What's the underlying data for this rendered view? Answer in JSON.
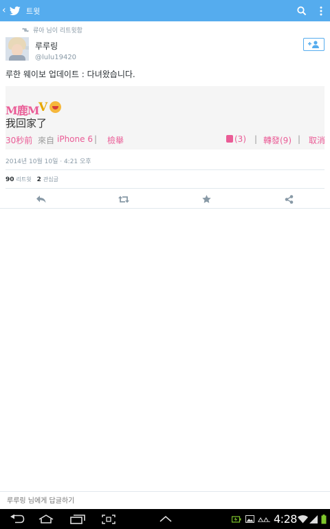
{
  "action_bar": {
    "title": "트윗",
    "background": "#55acee",
    "back_icon": "chevron-left-icon",
    "logo_icon": "twitter-bird-icon",
    "search_icon": "search-icon",
    "overflow_icon": "overflow-menu-icon"
  },
  "tweet": {
    "retweet_context": "류아 님이 리트윗함",
    "author": {
      "display_name": "루루링",
      "handle": "@lulu19420"
    },
    "text": "루한 웨이보 업데이트 : 다녀왔습니다.",
    "image": {
      "name_tag": "M鹿M",
      "v_badge": "V",
      "post_text": "我回家了",
      "time": "30秒前",
      "source_prefix": "來自",
      "source": "iPhone 6",
      "separator": "|",
      "report": "檢舉",
      "likes": "(3)",
      "repost": "轉發(9)",
      "cancel": "取消"
    },
    "timestamp": "2014년 10월 10일 · 4:21 오후",
    "retweet_count": "90",
    "retweet_label": "리트윗",
    "favorite_count": "2",
    "favorite_label": "관심글"
  },
  "actions": {
    "reply_icon": "reply-icon",
    "retweet_icon": "retweet-icon",
    "favorite_icon": "star-icon",
    "share_icon": "share-icon"
  },
  "reply_box": {
    "placeholder": "루루링 님에게 답글하기"
  },
  "system_bar": {
    "time": "4:28",
    "icons": [
      "back-icon",
      "home-icon",
      "recent-apps-icon",
      "screenshot-icon",
      "up-chevron-icon",
      "battery-charging-icon",
      "gallery-icon",
      "signal-text-icon",
      "wifi-icon",
      "cell-signal-icon",
      "battery-icon"
    ]
  },
  "colors": {
    "accent": "#55acee",
    "weibo_pink": "#ea5c96",
    "muted_text": "#8899a6"
  }
}
